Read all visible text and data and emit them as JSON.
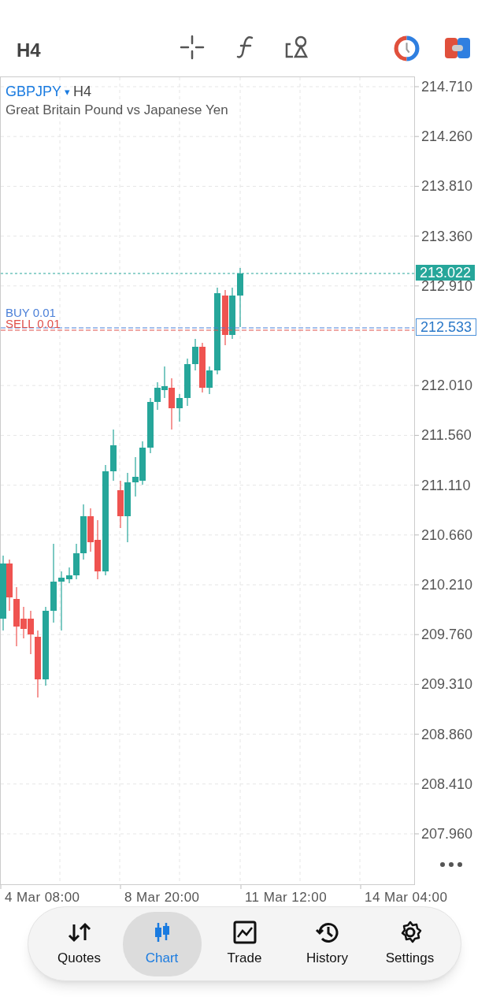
{
  "toolbar": {
    "timeframe": "H4"
  },
  "chart": {
    "symbol": "GBPJPY",
    "dropdown_glyph": "▾",
    "timeframe": "H4",
    "description": "Great Britain Pound vs Japanese Yen",
    "price_labels": [
      "214.710",
      "214.260",
      "213.810",
      "213.360",
      "212.910",
      "212.010",
      "211.560",
      "211.110",
      "210.660",
      "210.210",
      "209.760",
      "209.310",
      "208.860",
      "208.410",
      "207.960"
    ],
    "current_price": "213.022",
    "orders": [
      {
        "label": "BUY 0.01",
        "kind": "buy"
      },
      {
        "label": "SELL 0.01",
        "kind": "sell"
      }
    ],
    "order_price": "212.533",
    "time_labels": [
      "4 Mar 08:00",
      "8 Mar 20:00",
      "11 Mar 12:00",
      "14 Mar 04:00"
    ]
  },
  "nav": [
    {
      "label": "Quotes",
      "kind": "quotes",
      "selected": false
    },
    {
      "label": "Chart",
      "kind": "chart",
      "selected": true
    },
    {
      "label": "Trade",
      "kind": "trade",
      "selected": false
    },
    {
      "label": "History",
      "kind": "history",
      "selected": false
    },
    {
      "label": "Settings",
      "kind": "settings",
      "selected": false
    }
  ]
}
